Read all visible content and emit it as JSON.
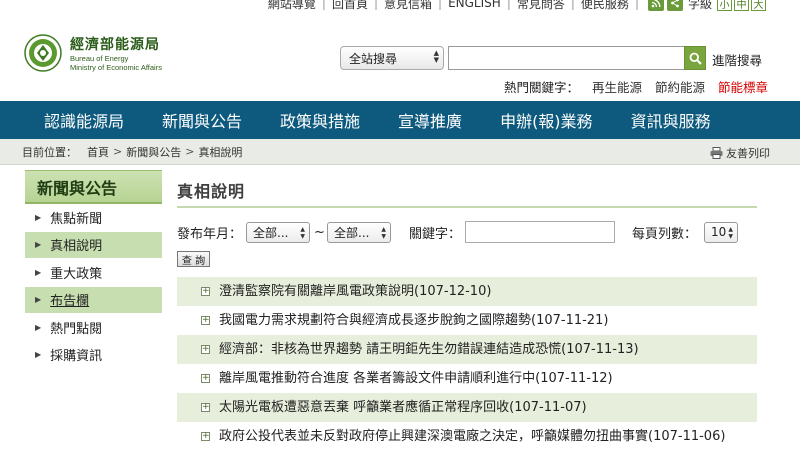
{
  "top_links": {
    "sitemap": "網站導覽",
    "home": "回首頁",
    "mailbox": "意見信箱",
    "english": "ENGLISH",
    "faq": "常見問答",
    "service": "便民服務",
    "font_label": "字級",
    "font_sizes": [
      "小",
      "中",
      "大"
    ]
  },
  "logo": {
    "cn": "經濟部能源局",
    "en_line1": "Bureau of Energy",
    "en_line2": "Ministry of Economic Affairs"
  },
  "search": {
    "scope_value": "全站搜尋",
    "advanced": "進階搜尋",
    "hot_label": "熱門關鍵字：",
    "hot_keywords": [
      "再生能源",
      "節約能源",
      "節能標章"
    ]
  },
  "main_nav": [
    "認識能源局",
    "新聞與公告",
    "政策與措施",
    "宣導推廣",
    "申辦(報)業務",
    "資訊與服務"
  ],
  "breadcrumb": {
    "label": "目前位置：",
    "items": [
      "首頁",
      "新聞與公告",
      "真相說明"
    ],
    "print": "友善列印"
  },
  "sidebar": {
    "title": "新聞與公告",
    "items": [
      "焦點新聞",
      "真相說明",
      "重大政策",
      "布告欄",
      "熱門點閱",
      "採購資訊"
    ]
  },
  "content": {
    "title": "真相說明",
    "filters": {
      "date_label": "發布年月：",
      "from_value": "全部...",
      "tilde": "~",
      "to_value": "全部...",
      "keyword_label": "關鍵字：",
      "per_page_label": "每頁列數：",
      "per_page_value": "10"
    },
    "query_button": "查 詢",
    "news": [
      "澄清監察院有關離岸風電政策說明(107-12-10)",
      "我國電力需求規劃符合與經濟成長逐步脫鉤之國際趨勢(107-11-21)",
      "經濟部：非核為世界趨勢 請王明鉅先生勿錯誤連結造成恐慌(107-11-13)",
      "離岸風電推動符合進度 各業者籌設文件申請順利進行中(107-11-12)",
      "太陽光電板遭惡意丟棄 呼籲業者應循正常程序回收(107-11-07)",
      "政府公投代表並未反對政府停止興建深澳電廠之決定，呼籲媒體勿扭曲事實(107-11-06)"
    ]
  },
  "colors": {
    "nav_bg": "#0e5a7f",
    "sidebar_active": "#c7deb0",
    "row_alt": "#e7efdc",
    "hot_red": "#d40000",
    "search_green": "#7aa53e"
  }
}
